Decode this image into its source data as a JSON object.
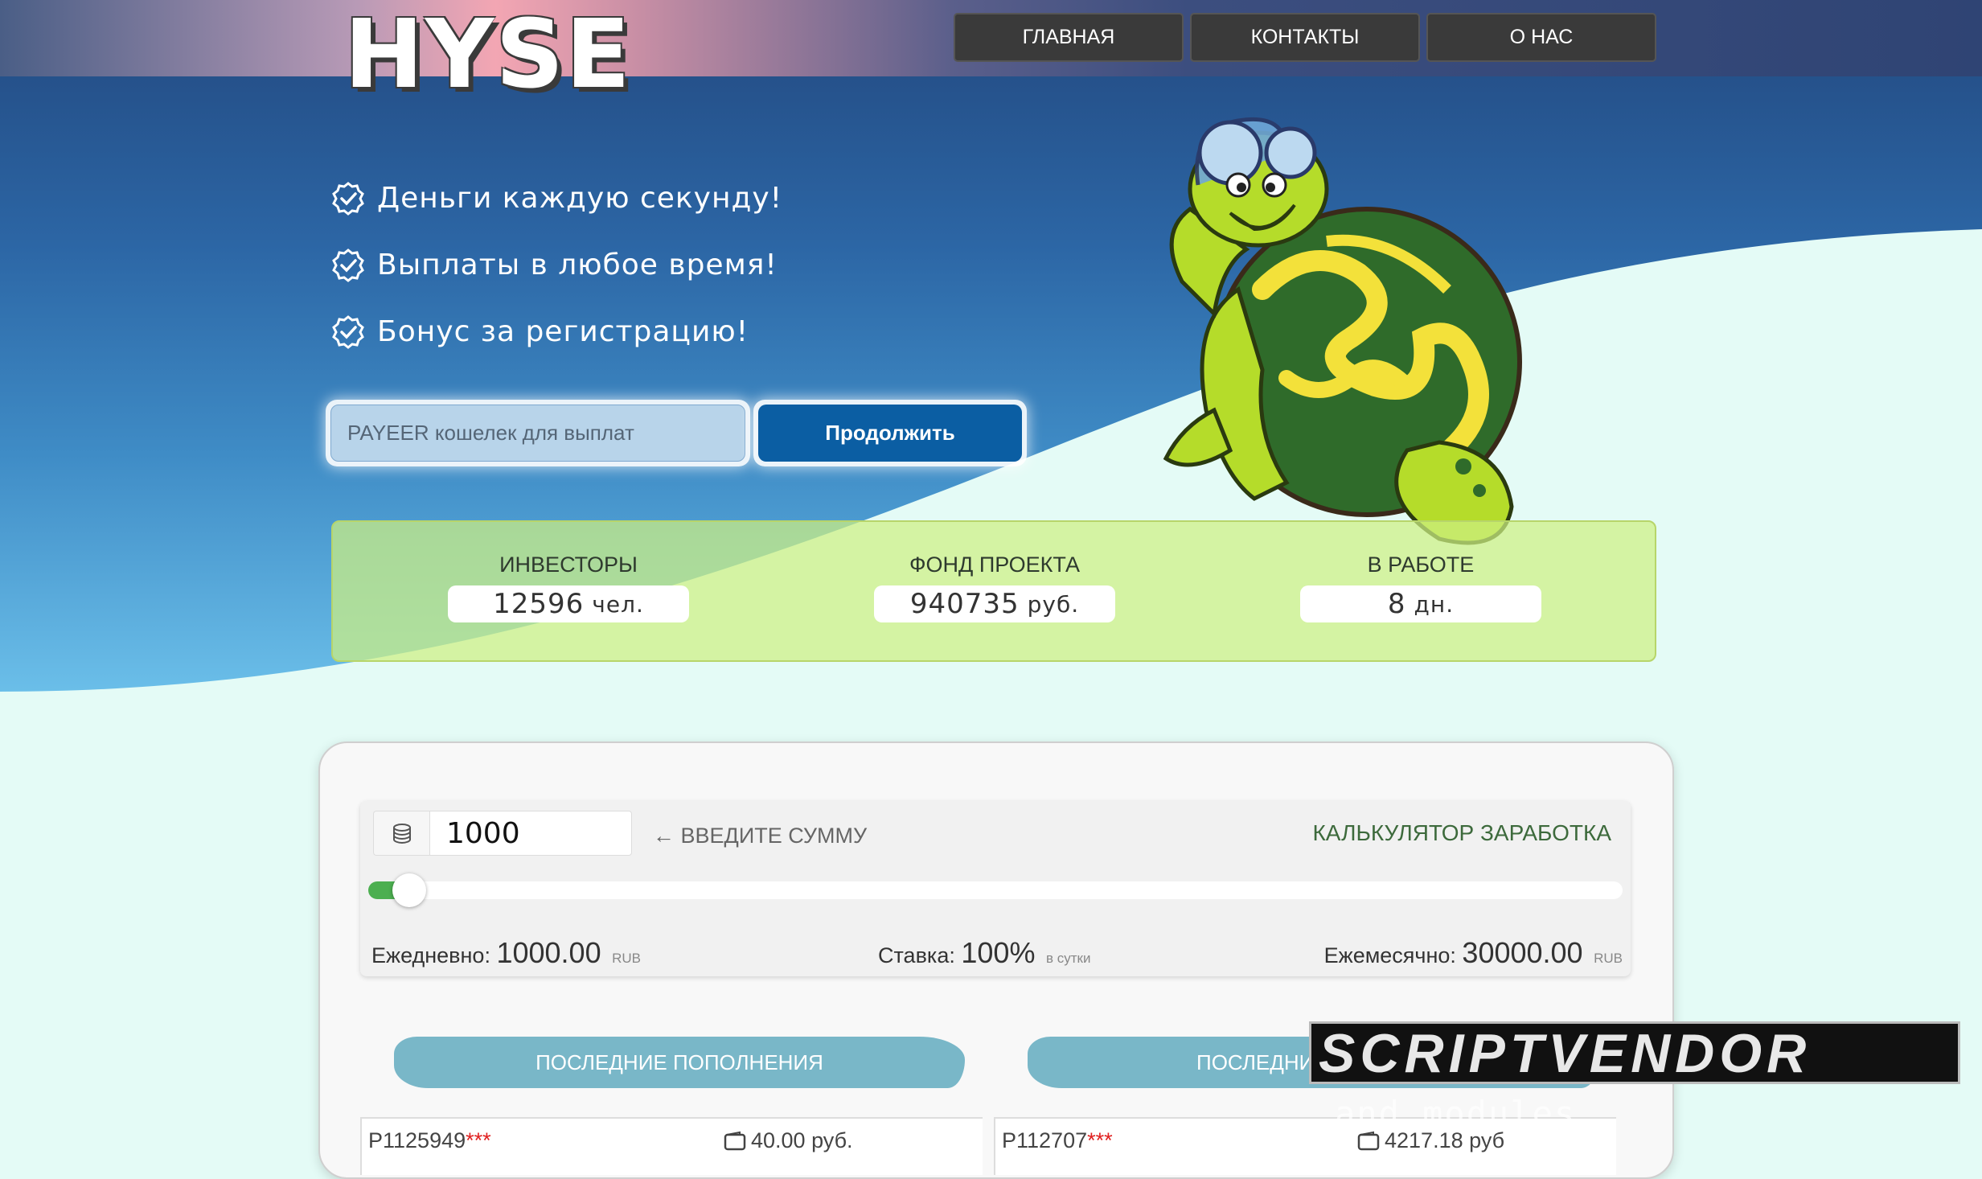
{
  "brand": {
    "logo_text": "HYSE"
  },
  "nav": [
    {
      "label": "ГЛАВНАЯ"
    },
    {
      "label": "КОНТАКТЫ"
    },
    {
      "label": "О НАС"
    }
  ],
  "features": [
    "Деньги каждую секунду!",
    "Выплаты в любое время!",
    "Бонус за регистрацию!"
  ],
  "signup": {
    "wallet_placeholder": "PAYEER кошелек для выплат",
    "continue_label": "Продолжить"
  },
  "stats": [
    {
      "label": "ИНВЕСТОРЫ",
      "value": "12596",
      "unit": "чел."
    },
    {
      "label": "ФОНД ПРОЕКТА",
      "value": "940735",
      "unit": "руб."
    },
    {
      "label": "В РАБОТЕ",
      "value": "8",
      "unit": "дн."
    }
  ],
  "calculator": {
    "amount": "1000",
    "hint": "← ВВЕДИТЕ СУММУ",
    "title": "КАЛЬКУЛЯТОР ЗАРАБОТКА",
    "slider_fraction": 0.01,
    "daily_label": "Ежедневно:",
    "daily_value": "1000.00",
    "daily_currency": "RUB",
    "rate_label": "Ставка:",
    "rate_value": "100%",
    "rate_period": "в сутки",
    "monthly_label": "Ежемесячно:",
    "monthly_value": "30000.00",
    "monthly_currency": "RUB"
  },
  "tabs": {
    "deposits_label": "ПОСЛЕДНИЕ ПОПОЛНЕНИЯ",
    "withdrawals_label": "ПОСЛЕДНИ"
  },
  "deposits": [
    {
      "account": "P1125949",
      "mask": "***",
      "amount": "40.00 руб."
    }
  ],
  "withdrawals": [
    {
      "account": "P112707",
      "mask": "***",
      "amount": "4217.18 руб"
    }
  ],
  "watermark": {
    "text": "SCRIPTVENDOR",
    "sub": "and modules_"
  },
  "colors": {
    "nav_bg": "#3a3a3a",
    "accent_blue": "#0b5ea3",
    "slider_fill": "#4caf50",
    "tab_bg": "#79b7c8"
  }
}
